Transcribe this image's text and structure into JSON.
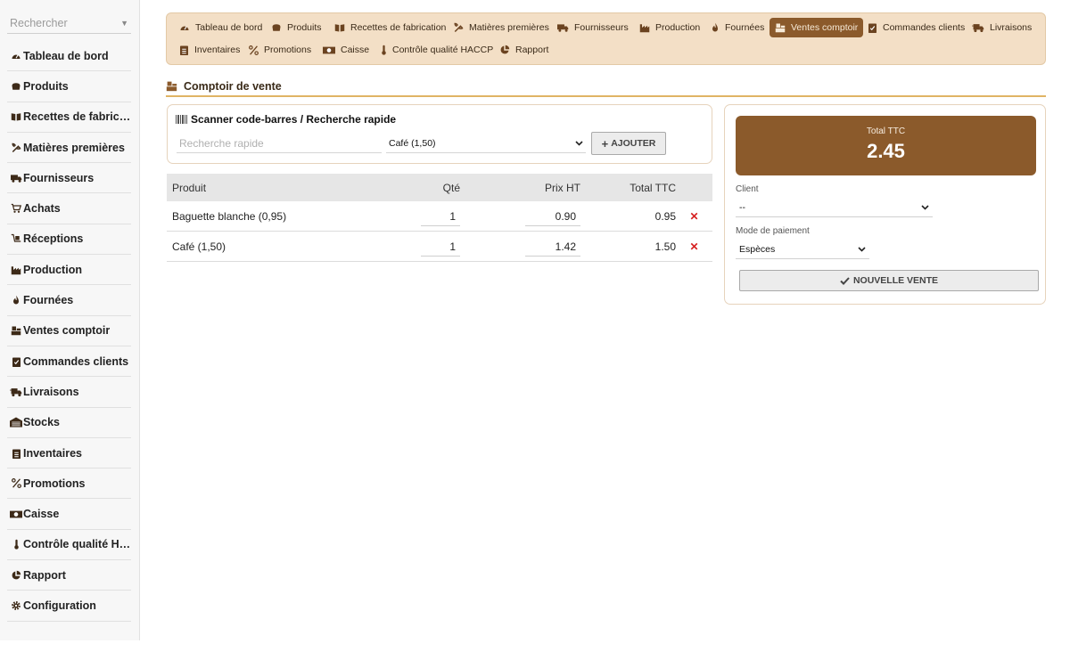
{
  "sidebar": {
    "search_placeholder": "Rechercher",
    "items": [
      {
        "label": "Tableau de bord",
        "icon": "gauge-icon"
      },
      {
        "label": "Produits",
        "icon": "bread-icon"
      },
      {
        "label": "Recettes de fabrication",
        "icon": "book-icon"
      },
      {
        "label": "Matières premières",
        "icon": "wheat-icon"
      },
      {
        "label": "Fournisseurs",
        "icon": "truck-icon"
      },
      {
        "label": "Achats",
        "icon": "cart-icon"
      },
      {
        "label": "Réceptions",
        "icon": "dolly-icon"
      },
      {
        "label": "Production",
        "icon": "factory-icon"
      },
      {
        "label": "Fournées",
        "icon": "flame-icon"
      },
      {
        "label": "Ventes comptoir",
        "icon": "cash-register-icon"
      },
      {
        "label": "Commandes clients",
        "icon": "clipboard-check-icon"
      },
      {
        "label": "Livraisons",
        "icon": "truck-fast-icon"
      },
      {
        "label": "Stocks",
        "icon": "warehouse-icon"
      },
      {
        "label": "Inventaires",
        "icon": "clipboard-list-icon"
      },
      {
        "label": "Promotions",
        "icon": "percent-icon"
      },
      {
        "label": "Caisse",
        "icon": "money-bill-icon"
      },
      {
        "label": "Contrôle qualité HACCP",
        "icon": "thermometer-icon"
      },
      {
        "label": "Rapport",
        "icon": "chart-pie-icon"
      },
      {
        "label": "Configuration",
        "icon": "gear-icon"
      }
    ]
  },
  "tabs": [
    {
      "label": "Tableau de bord",
      "icon": "gauge-icon"
    },
    {
      "label": "Produits",
      "icon": "bread-icon"
    },
    {
      "label": "Recettes de fabrication",
      "icon": "book-icon"
    },
    {
      "label": "Matières premières",
      "icon": "wheat-icon"
    },
    {
      "label": "Fournisseurs",
      "icon": "truck-icon"
    },
    {
      "label": "Production",
      "icon": "factory-icon"
    },
    {
      "label": "Fournées",
      "icon": "flame-icon"
    },
    {
      "label": "Ventes comptoir",
      "icon": "cash-register-icon",
      "active": true
    },
    {
      "label": "Commandes clients",
      "icon": "clipboard-check-icon"
    },
    {
      "label": "Livraisons",
      "icon": "truck-fast-icon"
    },
    {
      "label": "Inventaires",
      "icon": "clipboard-list-icon"
    },
    {
      "label": "Promotions",
      "icon": "percent-icon"
    },
    {
      "label": "Caisse",
      "icon": "money-bill-icon"
    },
    {
      "label": "Contrôle qualité HACCP",
      "icon": "thermometer-icon"
    },
    {
      "label": "Rapport",
      "icon": "chart-pie-icon"
    }
  ],
  "section": {
    "title": "Comptoir de vente",
    "icon": "cash-register-icon"
  },
  "scanner": {
    "title": "Scanner code-barres / Recherche rapide",
    "quick_search_placeholder": "Recherche rapide",
    "product_selected": "Café (1,50)",
    "add_label": "AJOUTER"
  },
  "cart": {
    "columns": {
      "product": "Produit",
      "qty": "Qté",
      "price": "Prix HT",
      "total": "Total TTC"
    },
    "rows": [
      {
        "product": "Baguette blanche (0,95)",
        "qty": "1",
        "price": "0.90",
        "total": "0.95"
      },
      {
        "product": "Café (1,50)",
        "qty": "1",
        "price": "1.42",
        "total": "1.50"
      }
    ]
  },
  "summary": {
    "total_label": "Total TTC",
    "total_value": "2.45",
    "client_label": "Client",
    "client_value": "--",
    "payment_label": "Mode de paiement",
    "payment_value": "Espèces",
    "new_sale_label": "NOUVELLE VENTE"
  },
  "colors": {
    "accent": "#8b5a2b",
    "tabbar_bg": "#f3dfc6",
    "underline": "#e0b465",
    "delete": "#d62020"
  }
}
